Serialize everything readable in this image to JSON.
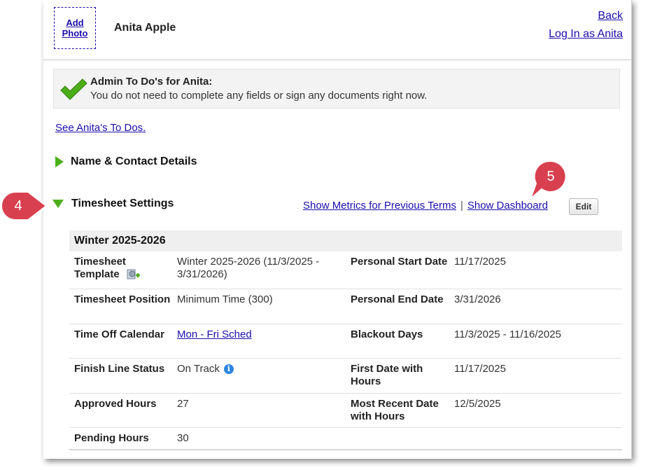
{
  "header": {
    "add_photo_line1": "Add",
    "add_photo_line2": "Photo",
    "person_name": "Anita Apple",
    "back_link": "Back",
    "login_as_link": "Log In as Anita"
  },
  "admin_todos": {
    "title": "Admin To Do's for Anita:",
    "message": "You do not need to complete any fields or sign any documents right now.",
    "see_todos_link": "See Anita's To Dos."
  },
  "sections": {
    "name_contact": "Name & Contact Details",
    "timesheet_settings": "Timesheet Settings"
  },
  "timesheet_actions": {
    "show_metrics": "Show Metrics for Previous Terms",
    "separator": "|",
    "show_dashboard": "Show Dashboard",
    "edit": "Edit"
  },
  "callouts": {
    "four": "4",
    "five": "5",
    "color": "#d9404f"
  },
  "term": {
    "name": "Winter 2025-2026",
    "rows": [
      {
        "l1": "Timesheet Template",
        "v1": "Winter 2025-2026 (11/3/2025 - 3/31/2026)",
        "l2": "Personal Start Date",
        "v2": "11/17/2025"
      },
      {
        "l1": "Timesheet Position",
        "v1": "Minimum Time (300)",
        "l2": "Personal End Date",
        "v2": "3/31/2026"
      },
      {
        "l1": "Time Off Calendar",
        "v1": "Mon - Fri Sched",
        "l2": "Blackout Days",
        "v2": "11/3/2025 - 11/16/2025"
      },
      {
        "l1": "Finish Line Status",
        "v1": "On Track",
        "l2": "First Date with Hours",
        "v2": "11/17/2025"
      },
      {
        "l1": "Approved Hours",
        "v1": "27",
        "l2": "Most Recent Date with Hours",
        "v2": "12/5/2025"
      },
      {
        "l1": "Pending Hours",
        "v1": "30",
        "l2": "",
        "v2": ""
      }
    ]
  },
  "colors": {
    "link": "#1a0dab",
    "accent_green": "#4caf1a",
    "info_blue": "#2e86de"
  },
  "icons": {
    "check": "check-icon",
    "template": "template-settings-icon",
    "info": "info-icon"
  }
}
